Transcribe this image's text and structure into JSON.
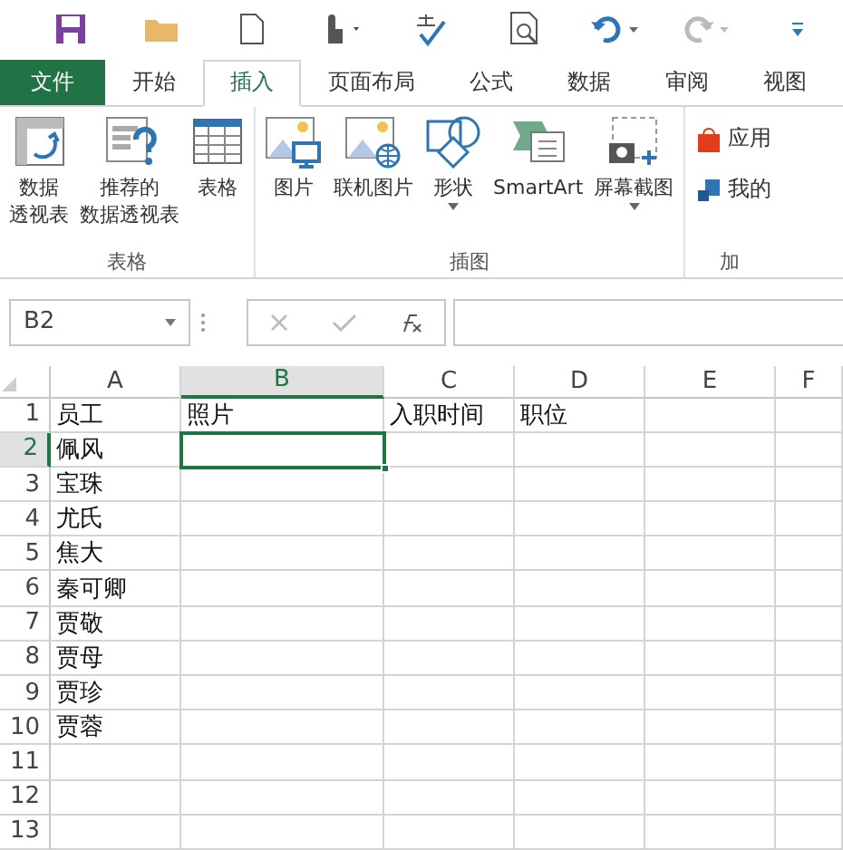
{
  "tabs": [
    {
      "label": "文件",
      "kind": "file",
      "selected": false
    },
    {
      "label": "开始",
      "kind": "tab",
      "selected": false
    },
    {
      "label": "插入",
      "kind": "tab",
      "selected": true
    },
    {
      "label": "页面布局",
      "kind": "tab",
      "selected": false
    },
    {
      "label": "公式",
      "kind": "tab",
      "selected": false
    },
    {
      "label": "数据",
      "kind": "tab",
      "selected": false
    },
    {
      "label": "审阅",
      "kind": "tab",
      "selected": false
    },
    {
      "label": "视图",
      "kind": "tab",
      "selected": false
    }
  ],
  "ribbon_groups": [
    {
      "label": "表格",
      "buttons": [
        {
          "lines": [
            "数据",
            "透视表"
          ],
          "dropdown": false
        },
        {
          "lines": [
            "推荐的",
            "数据透视表"
          ],
          "dropdown": false
        },
        {
          "lines": [
            "表格"
          ],
          "dropdown": false
        }
      ]
    },
    {
      "label": "插图",
      "buttons": [
        {
          "lines": [
            "图片"
          ],
          "dropdown": false
        },
        {
          "lines": [
            "联机图片"
          ],
          "dropdown": false
        },
        {
          "lines": [
            "形状"
          ],
          "dropdown": true
        },
        {
          "lines": [
            "SmartArt"
          ],
          "dropdown": false
        },
        {
          "lines": [
            "屏幕截图"
          ],
          "dropdown": true
        }
      ]
    },
    {
      "label": "加",
      "small_buttons": [
        {
          "label": "应用"
        },
        {
          "label": "我的"
        }
      ]
    }
  ],
  "name_box": "B2",
  "columns": [
    {
      "label": "A",
      "selected": false
    },
    {
      "label": "B",
      "selected": true
    },
    {
      "label": "C",
      "selected": false
    },
    {
      "label": "D",
      "selected": false
    },
    {
      "label": "E",
      "selected": false
    },
    {
      "label": "F",
      "selected": false
    }
  ],
  "rows": [
    {
      "number": "1",
      "selected": false,
      "cells": [
        {
          "text": "员工",
          "active": false
        },
        {
          "text": "照片",
          "active": false
        },
        {
          "text": "入职时间",
          "active": false
        },
        {
          "text": "职位",
          "active": false
        }
      ]
    },
    {
      "number": "2",
      "selected": true,
      "cells": [
        {
          "text": "佩风",
          "active": false
        },
        {
          "active": true
        }
      ]
    },
    {
      "number": "3",
      "selected": false,
      "cells": [
        {
          "text": "宝珠",
          "active": false
        }
      ]
    },
    {
      "number": "4",
      "selected": false,
      "cells": [
        {
          "text": "尤氏",
          "active": false
        }
      ]
    },
    {
      "number": "5",
      "selected": false,
      "cells": [
        {
          "text": "焦大",
          "active": false
        }
      ]
    },
    {
      "number": "6",
      "selected": false,
      "cells": [
        {
          "text": "秦可卿",
          "active": false
        }
      ]
    },
    {
      "number": "7",
      "selected": false,
      "cells": [
        {
          "text": "贾敬",
          "active": false
        }
      ]
    },
    {
      "number": "8",
      "selected": false,
      "cells": [
        {
          "text": "贾母",
          "active": false
        }
      ]
    },
    {
      "number": "9",
      "selected": false,
      "cells": [
        {
          "text": "贾珍",
          "active": false
        }
      ]
    },
    {
      "number": "10",
      "selected": false,
      "cells": [
        {
          "text": "贾蓉",
          "active": false
        }
      ]
    },
    {
      "number": "11",
      "selected": false
    },
    {
      "number": "12",
      "selected": false
    },
    {
      "number": "13",
      "selected": false
    }
  ]
}
